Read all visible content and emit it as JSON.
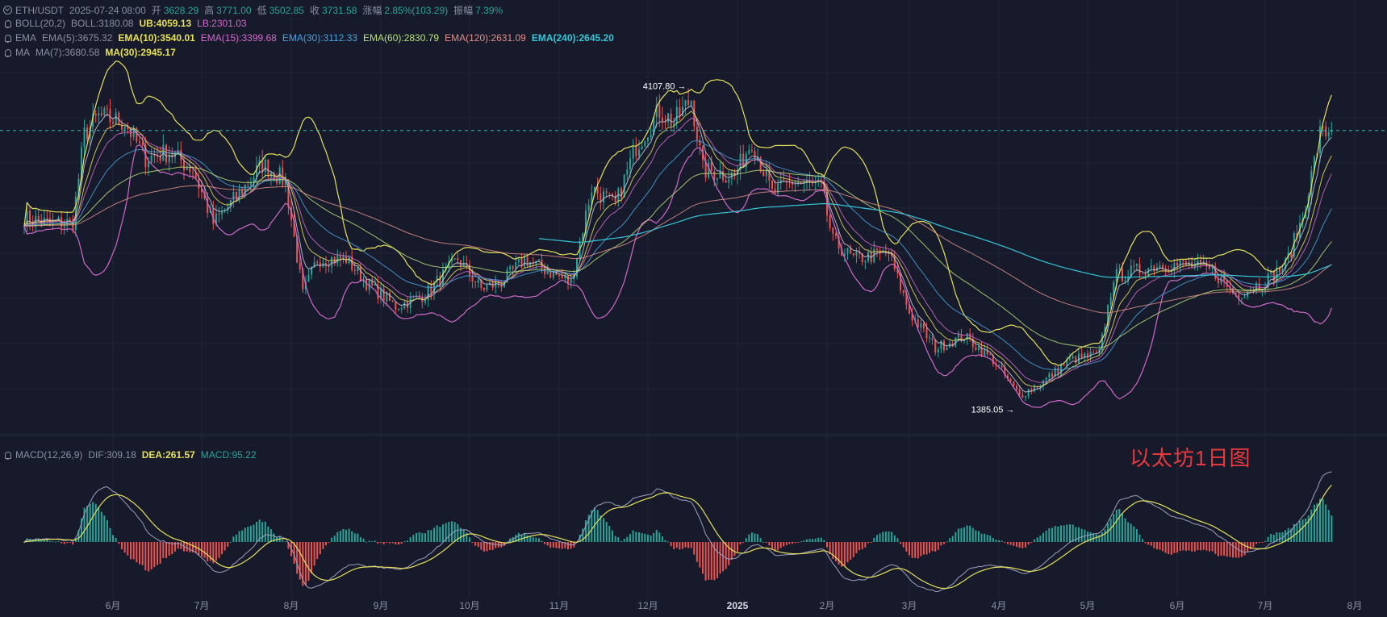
{
  "header": {
    "symbol": "ETH/USDT",
    "datetime": "2025-07-24 08:00",
    "open_label": "开",
    "open": "3628.29",
    "high_label": "高",
    "high": "3771.00",
    "low_label": "低",
    "low": "3502.85",
    "close_label": "收",
    "close": "3731.58",
    "change_label": "涨幅",
    "change": "2.85%(103.29)",
    "amplitude_label": "振幅",
    "amplitude": "7.39%"
  },
  "boll": {
    "name": "BOLL(20,2)",
    "mid": "BOLL:3180.08",
    "ub": "UB:4059.13",
    "lb": "LB:2301.03"
  },
  "ema": {
    "name": "EMA",
    "e5": "EMA(5):3675.32",
    "e10": "EMA(10):3540.01",
    "e15": "EMA(15):3399.68",
    "e30": "EMA(30):3112.33",
    "e60": "EMA(60):2830.79",
    "e120": "EMA(120):2631.09",
    "e240": "EMA(240):2645.20"
  },
  "ma": {
    "name": "MA",
    "m7": "MA(7):3680.58",
    "m30": "MA(30):2945.17"
  },
  "macd": {
    "name": "MACD(12,26,9)",
    "dif": "DIF:309.18",
    "dea": "DEA:261.57",
    "macd": "MACD:95.22"
  },
  "annotations": {
    "high": "4107.80",
    "low": "1385.05"
  },
  "watermark": "以太坊1日图",
  "colors": {
    "up": "#26a69a",
    "down": "#ef5350",
    "boll_band": "#d16ac9",
    "boll_upper": "#e6e05a",
    "ema5": "#c9c9e0",
    "ema10": "#e6e05a",
    "ema15": "#d16ac9",
    "ema30": "#4aa3e0",
    "ema60": "#b8e07a",
    "ema120": "#e0908a",
    "ema240": "#35c7d8",
    "price_line": "#3bb8b8"
  },
  "chart_data": {
    "type": "candlestick",
    "x_axis": {
      "ticks": [
        "6月",
        "7月",
        "8月",
        "9月",
        "10月",
        "11月",
        "12月",
        "2025",
        "2月",
        "3月",
        "4月",
        "5月",
        "6月",
        "7月",
        "8月"
      ]
    },
    "price_range": [
      1300,
      4300
    ],
    "period_high": 4107.8,
    "period_low": 1385.05,
    "current_price": 3731.58,
    "price_path": [
      [
        "2024-05-01",
        3000
      ],
      [
        "2024-05-10",
        2950
      ],
      [
        "2024-05-18",
        2960
      ],
      [
        "2024-05-22",
        3700
      ],
      [
        "2024-05-27",
        3850
      ],
      [
        "2024-06-05",
        3800
      ],
      [
        "2024-06-12",
        3500
      ],
      [
        "2024-06-20",
        3550
      ],
      [
        "2024-06-28",
        3400
      ],
      [
        "2024-07-05",
        2950
      ],
      [
        "2024-07-14",
        3200
      ],
      [
        "2024-07-22",
        3450
      ],
      [
        "2024-07-30",
        3300
      ],
      [
        "2024-08-05",
        2350
      ],
      [
        "2024-08-10",
        2650
      ],
      [
        "2024-08-20",
        2650
      ],
      [
        "2024-08-27",
        2450
      ],
      [
        "2024-09-06",
        2250
      ],
      [
        "2024-09-16",
        2350
      ],
      [
        "2024-09-27",
        2650
      ],
      [
        "2024-10-05",
        2400
      ],
      [
        "2024-10-12",
        2450
      ],
      [
        "2024-10-20",
        2650
      ],
      [
        "2024-10-28",
        2550
      ],
      [
        "2024-11-05",
        2450
      ],
      [
        "2024-11-12",
        3250
      ],
      [
        "2024-11-20",
        3100
      ],
      [
        "2024-11-27",
        3600
      ],
      [
        "2024-12-05",
        3900
      ],
      [
        "2024-12-10",
        3800
      ],
      [
        "2024-12-16",
        4000
      ],
      [
        "2024-12-20",
        3400
      ],
      [
        "2024-12-31",
        3350
      ],
      [
        "2025-01-06",
        3650
      ],
      [
        "2025-01-13",
        3200
      ],
      [
        "2025-01-20",
        3300
      ],
      [
        "2025-01-30",
        3250
      ],
      [
        "2025-02-03",
        2800
      ],
      [
        "2025-02-10",
        2650
      ],
      [
        "2025-02-22",
        2700
      ],
      [
        "2025-03-01",
        2200
      ],
      [
        "2025-03-10",
        1900
      ],
      [
        "2025-03-20",
        2000
      ],
      [
        "2025-03-30",
        1800
      ],
      [
        "2025-04-08",
        1500
      ],
      [
        "2025-04-15",
        1600
      ],
      [
        "2025-04-25",
        1800
      ],
      [
        "2025-05-05",
        1850
      ],
      [
        "2025-05-10",
        2500
      ],
      [
        "2025-05-18",
        2550
      ],
      [
        "2025-05-25",
        2600
      ],
      [
        "2025-06-05",
        2600
      ],
      [
        "2025-06-13",
        2550
      ],
      [
        "2025-06-21",
        2350
      ],
      [
        "2025-06-30",
        2450
      ],
      [
        "2025-07-08",
        2600
      ],
      [
        "2025-07-14",
        3000
      ],
      [
        "2025-07-20",
        3700
      ],
      [
        "2025-07-24",
        3731.58
      ]
    ]
  }
}
